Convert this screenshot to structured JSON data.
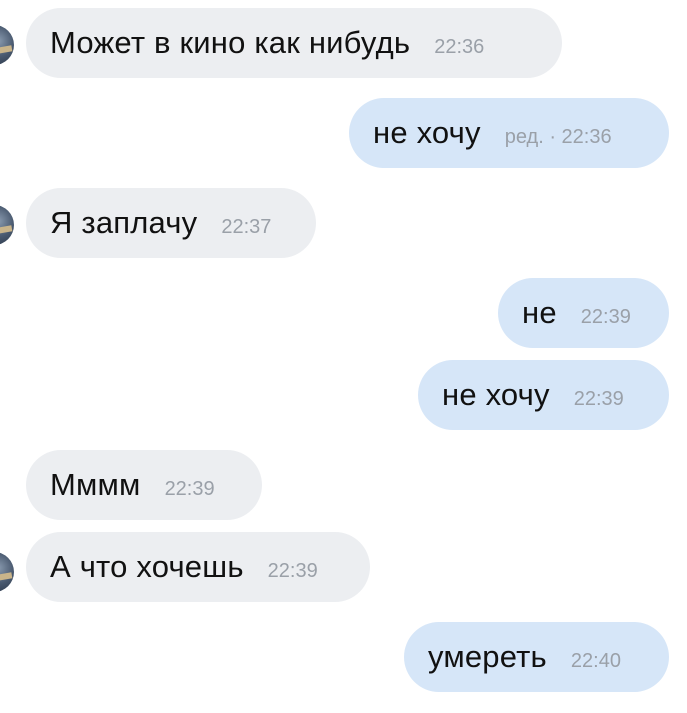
{
  "messages": [
    {
      "direction": "in",
      "text": "Может в кино как нибудь",
      "time": "22:36"
    },
    {
      "direction": "out",
      "text": "не хочу",
      "time": "ред. · 22:36"
    },
    {
      "direction": "in",
      "text": "Я заплачу",
      "time": "22:37"
    },
    {
      "direction": "out",
      "text": "не",
      "time": "22:39"
    },
    {
      "direction": "out",
      "text": "не хочу",
      "time": "22:39"
    },
    {
      "direction": "in",
      "text": "Мммм",
      "time": "22:39"
    },
    {
      "direction": "in",
      "text": "А что хочешь",
      "time": "22:39"
    },
    {
      "direction": "out",
      "text": "умереть",
      "time": "22:40"
    }
  ]
}
